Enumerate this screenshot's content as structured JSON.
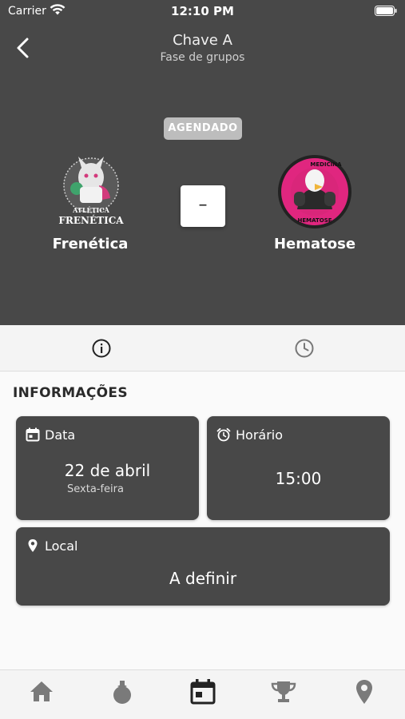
{
  "status_bar": {
    "carrier": "Carrier",
    "time": "12:10 PM"
  },
  "header": {
    "title": "Chave A",
    "subtitle": "Fase de grupos"
  },
  "match": {
    "status": "AGENDADO",
    "score": "–",
    "home": {
      "name": "Frenética",
      "logo_text_1": "ATLÉTICA",
      "logo_text_2": "FRENÉTICA"
    },
    "away": {
      "name": "Hematose",
      "logo_text_1": "MEDICINA",
      "logo_text_2": "HEMATOSE"
    }
  },
  "tabs": [
    {
      "name": "info",
      "icon": "info-icon",
      "active": true
    },
    {
      "name": "schedule",
      "icon": "clock-icon",
      "active": false
    }
  ],
  "info": {
    "section_title": "INFORMAÇÕES",
    "date": {
      "label": "Data",
      "value": "22 de abril",
      "weekday": "Sexta-feira",
      "icon": "calendar-icon"
    },
    "time": {
      "label": "Horário",
      "value": "15:00",
      "icon": "alarm-icon"
    },
    "location": {
      "label": "Local",
      "value": "A definir",
      "icon": "location-pin-icon"
    }
  },
  "bottom_nav": [
    {
      "name": "home",
      "icon": "home-icon"
    },
    {
      "name": "sports",
      "icon": "medal-icon"
    },
    {
      "name": "calendar",
      "icon": "calendar-icon",
      "active": true
    },
    {
      "name": "trophies",
      "icon": "trophy-icon"
    },
    {
      "name": "map",
      "icon": "location-pin-icon"
    }
  ],
  "colors": {
    "dark": "#484848",
    "badge": "#bdbdbd",
    "hematose_pink": "#e0267f",
    "active_icon": "#222222",
    "inactive_icon": "#7a7a7a"
  }
}
